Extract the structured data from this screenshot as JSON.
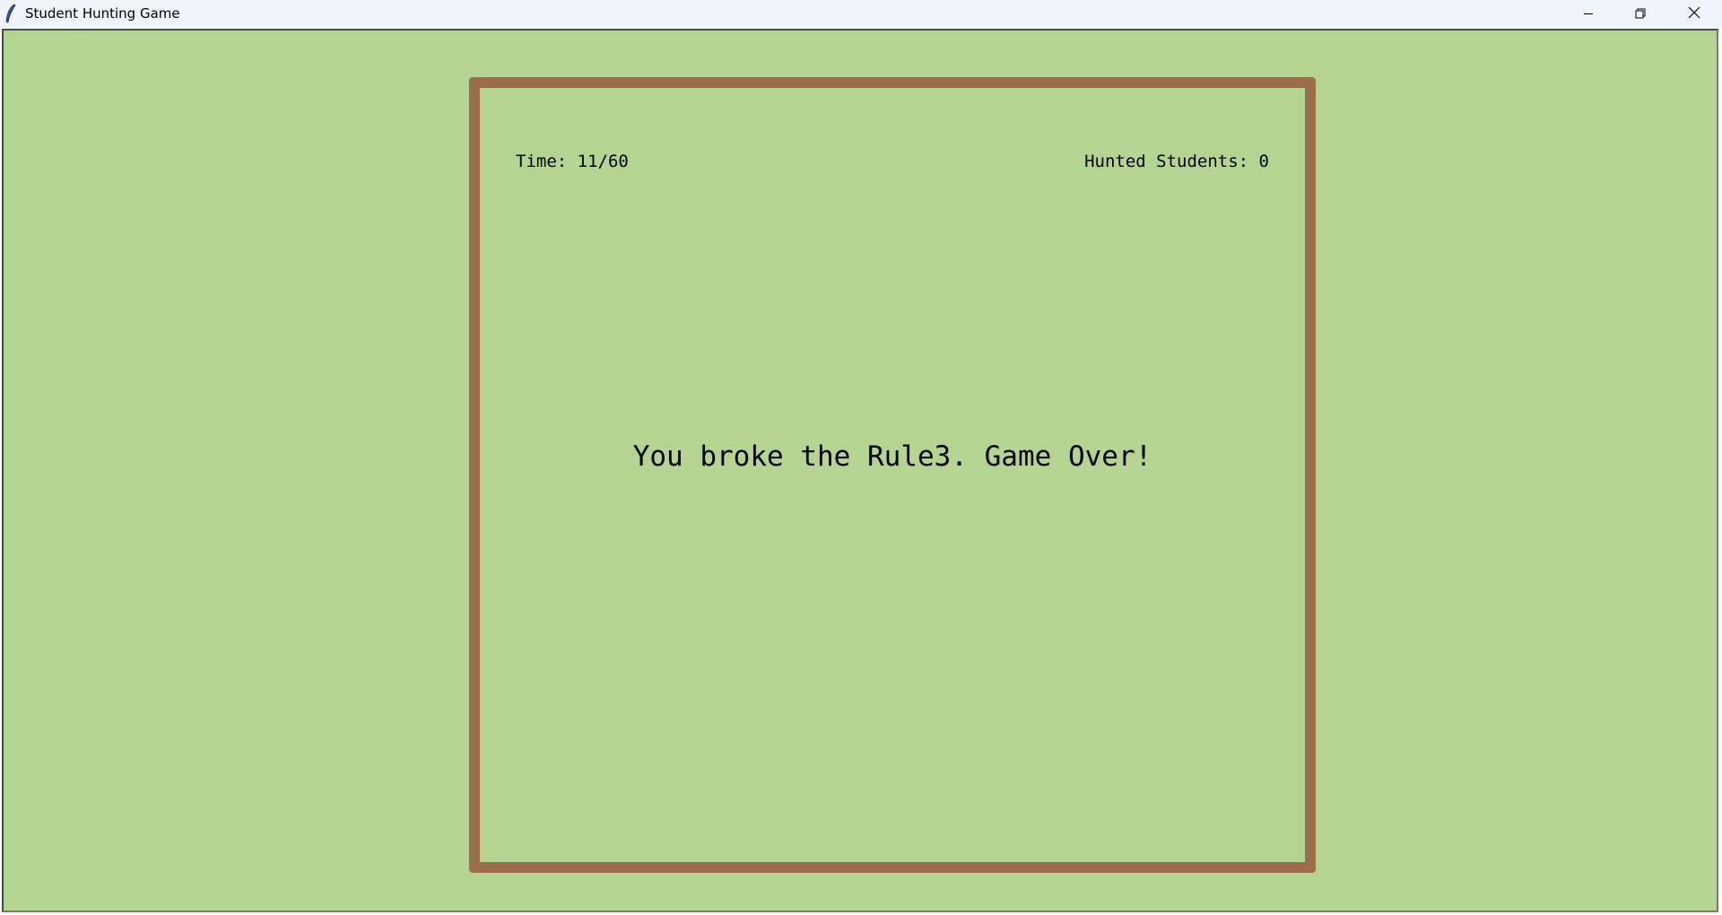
{
  "window": {
    "title": "Student Hunting Game",
    "app_icon": "feather-icon",
    "controls": {
      "minimize_icon": "minimize-icon",
      "maximize_icon": "restore-icon",
      "close_icon": "close-icon"
    }
  },
  "game": {
    "time_text": "Time: 11/60",
    "hunted_text": "Hunted Students: 0",
    "message": "You broke the Rule3. Game Over!"
  },
  "colors": {
    "background": "#b4d492",
    "board_border": "#9a6d4b",
    "titlebar": "#eff4fb",
    "text": "#000000"
  }
}
